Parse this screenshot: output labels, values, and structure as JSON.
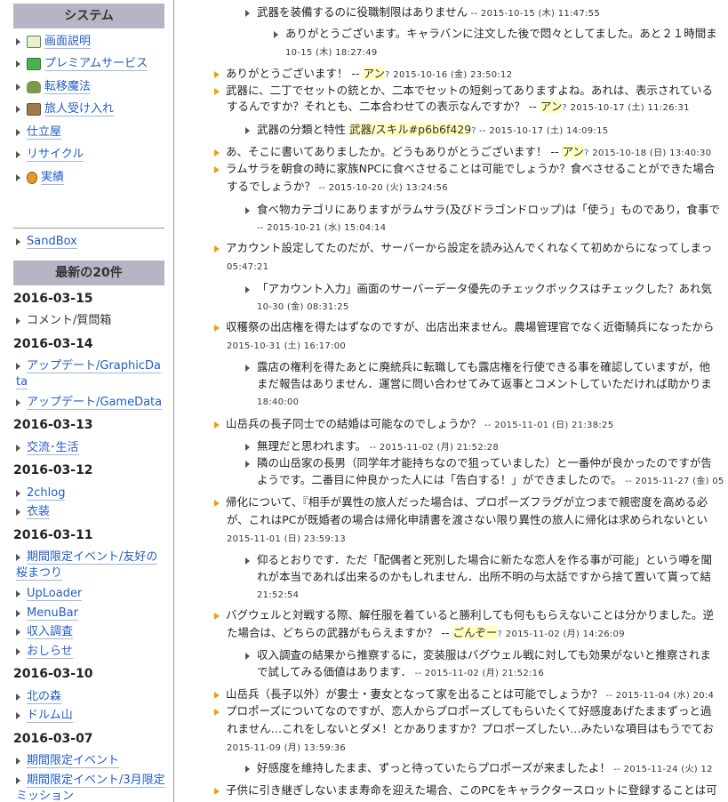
{
  "sidebar": {
    "system_title": "システム",
    "system_items": [
      {
        "label": "画面説明",
        "icon": "screen-icon",
        "color": "#5a8a3a"
      },
      {
        "label": "プレミアムサービス",
        "icon": "premium-icon",
        "color": "#4caf50"
      },
      {
        "label": "転移魔法",
        "icon": "car-icon",
        "color": "#6a8f3a"
      },
      {
        "label": "旅人受け入れ",
        "icon": "building-icon",
        "color": "#8a6a3a"
      },
      {
        "label": "仕立屋",
        "icon": "",
        "color": ""
      },
      {
        "label": "リサイクル",
        "icon": "",
        "color": ""
      },
      {
        "label": "実績",
        "icon": "medal-icon",
        "color": "#e0a020"
      }
    ],
    "sandbox": "SandBox",
    "recent_title": "最新の20件",
    "recent": [
      {
        "date": "2016-03-15",
        "items": [
          "コメント/質問箱"
        ]
      },
      {
        "date": "2016-03-14",
        "items": [
          "アップデート/GraphicData",
          "アップデート/GameData"
        ]
      },
      {
        "date": "2016-03-13",
        "items": [
          "交流･生活"
        ]
      },
      {
        "date": "2016-03-12",
        "items": [
          "2chlog",
          "衣装"
        ]
      },
      {
        "date": "2016-03-11",
        "items": [
          "期間限定イベント/友好の桜まつり",
          "UpLoader",
          "MenuBar",
          "収入調査",
          "おしらせ"
        ]
      },
      {
        "date": "2016-03-10",
        "items": [
          "北の森",
          "ドルム山"
        ]
      },
      {
        "date": "2016-03-07",
        "items": [
          "期間限定イベント",
          "期間限定イベント/3月限定ミッション"
        ]
      }
    ]
  },
  "comments": [
    {
      "text": "武器を装備するのに役職制限はありません",
      "ts": " -- 2015-10-15 (木) 11:47:55"
    },
    {
      "text": "ありがとうございます。キャラバンに注文した後で悶々としてました。あと２１時間ま"
    },
    {
      "ts": "10-15 (木) 18:27:49"
    },
    {
      "text": "ありがとうございます！ --",
      "user": "アン",
      "ts": "2015-10-16 (金) 23:50:12"
    },
    {
      "text": "武器に、二丁でセットの銃とか、二本でセットの短剣ってありますよね。あれは、表示されている"
    },
    {
      "text": "するんですか？それとも、二本合わせての表示なんですか？ --",
      "user": "アン",
      "ts": "2015-10-17 (土) 11:26:31"
    },
    {
      "text": "武器の分類と特性",
      "link": "武器/スキル#p6b6f429",
      "ts": " -- 2015-10-17 (土) 14:09:15"
    },
    {
      "text": "あ、そこに書いてありましたか。どうもありがとうございます！ --",
      "user": "アン",
      "ts": "2015-10-18 (日) 13:40:30"
    },
    {
      "text": "ラムサラを朝食の時に家族NPCに食べさせることは可能でしょうか？食べさせることができた場合"
    },
    {
      "text": "するでしょうか？",
      "ts": " -- 2015-10-20 (火) 13:24:56"
    },
    {
      "text": "食べ物カテゴリにありますがラムサラ(及びドラゴンドロップ)は「使う」ものであり，食事で"
    },
    {
      "ts": "-- 2015-10-21 (水) 15:04:14"
    },
    {
      "text": "アカウント設定してたのだが、サーバーから設定を読み込んでくれなくて初めからになってしまっ"
    },
    {
      "ts": "05:47:21"
    },
    {
      "text": "「アカウント入力」画面のサーバーデータ優先のチェックボックスはチェックした？あれ気"
    },
    {
      "ts": "10-30 (金) 08:31:25"
    },
    {
      "text": "収穫祭の出店権を得たはずなのですが、出店出来ません。農場管理官でなく近衛騎兵になったから"
    },
    {
      "ts": "2015-10-31 (土) 16:17:00"
    },
    {
      "text": "露店の権利を得たあとに廃統兵に転職しても露店権を行使できる事を確認していますが，他"
    },
    {
      "text": "まだ報告はありません．運営に問い合わせてみて返事とコメントしていただければ助かりま"
    },
    {
      "ts": "18:40:00"
    },
    {
      "text": "山岳兵の長子同士での結婚は可能なのでしょうか？",
      "ts": " -- 2015-11-01 (日) 21:38:25"
    },
    {
      "text": "無理だと思われます。",
      "ts": " -- 2015-11-02 (月) 21:52:28"
    },
    {
      "text": "隣の山岳家の長男（同学年才能持ちなので狙っていました）と一番仲が良かったのですが告"
    },
    {
      "text": "ようです。二番目に仲良かった人には「告白する！」ができましたので。",
      "ts": " -- 2015-11-27 (金) 05"
    },
    {
      "text": "帰化について、『相手が異性の旅人だった場合は、プロポーズフラグが立つまで親密度を高める必"
    },
    {
      "text": "が、これはPCが既婚者の場合は帰化申請書を渡さない限り異性の旅人に帰化は求められないとい"
    },
    {
      "ts": "2015-11-01 (日) 23:59:13"
    },
    {
      "text": "仰るとおりです．ただ「配偶者と死別した場合に新たな恋人を作る事が可能」という噂を聞"
    },
    {
      "text": "れが本当であれば出来るのかもしれません．出所不明の与太話ですから捨て置いて貰って結"
    },
    {
      "ts": "21:52:54"
    },
    {
      "text": "バグウェルと対戦する際、解任服を着ていると勝利しても何ももらえないことは分かりました。逆"
    },
    {
      "text": "た場合は、どちらの武器がもらえますか？ --",
      "user": "ごんぞー",
      "ts": "2015-11-02 (月) 14:26:09"
    },
    {
      "text": "収入調査の結果から推察するに，変装服はバグウェル戦に対しても効果がないと推察されま"
    },
    {
      "text": "で試してみる価値はあります．",
      "ts": " -- 2015-11-02 (月) 21:52:16"
    },
    {
      "text": "山岳兵（長子以外）が婁士・妻女となって家を出ることは可能でしょうか？",
      "ts": " -- 2015-11-04 (水) 20:4"
    },
    {
      "text": "プロポーズについてなのですが、恋人からプロポーズしてもらいたくて好感度あげたままずっと過"
    },
    {
      "text": "れません…これをしないとダメ！とかありますか？プロポーズしたい…みたいな項目はもうでてお"
    },
    {
      "ts": "2015-11-09 (月) 13:59:36"
    },
    {
      "text": "好感度を維持したまま、ずっと待っていたらプロポーズが来ましたよ！",
      "ts": " -- 2015-11-24 (火) 12"
    },
    {
      "text": "子供に引き継ぎしないまま寿命を迎えた場合、このPCをキャラクタースロットに登録することは可"
    }
  ]
}
